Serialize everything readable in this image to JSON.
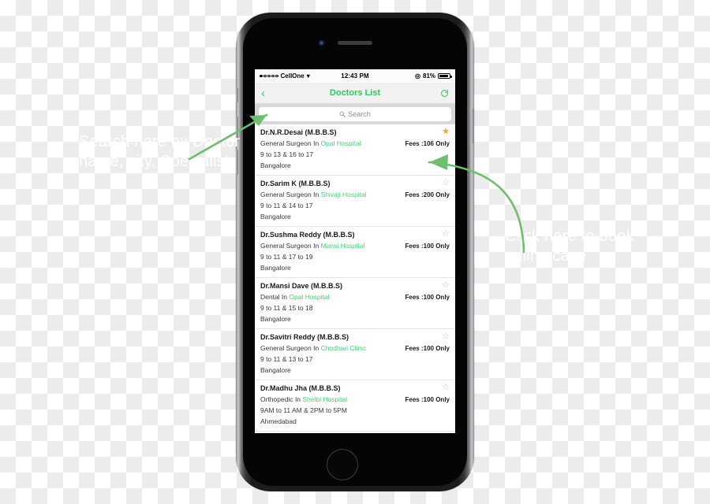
{
  "annotations": {
    "left": "Search here by Doctor name, city, Specialist",
    "right": "Click here to book online case"
  },
  "status_bar": {
    "carrier": "CellOne",
    "wifi_icon": "wifi-icon",
    "time": "12:43 PM",
    "bluetooth_icon": "bluetooth-icon",
    "battery_percent": "81%",
    "battery_icon": "battery-icon"
  },
  "nav_bar": {
    "back_icon": "chevron-left-icon",
    "title": "Doctors List",
    "refresh_icon": "refresh-icon"
  },
  "search": {
    "icon": "search-icon",
    "placeholder": "Search",
    "value": ""
  },
  "colors": {
    "accent_green": "#2ecc5a",
    "hospital_green": "#48d17a",
    "star_gold": "#f5a623",
    "arrow_green": "#6dbe6d",
    "navbar_gray": "#f2f2f2",
    "searchbar_gray": "#d8d8dc"
  },
  "doctors": [
    {
      "name": "Dr.N.R.Desai (M.B.B.S)",
      "specialty": "General Surgeon In ",
      "hospital": "Opal Hospital",
      "fees": "Fees :106 Only",
      "hours": "9 to 13 & 16 to 17",
      "city": "Bangalore",
      "favorite": true,
      "star_icon": "star-filled-icon"
    },
    {
      "name": "Dr.Sarim K (M.B.B.S)",
      "specialty": "General Surgeon In ",
      "hospital": "Shivaji Hospital",
      "fees": "Fees :200 Only",
      "hours": "9 to 11 & 14 to 17",
      "city": "Bangalore",
      "favorite": false,
      "star_icon": "star-outline-icon"
    },
    {
      "name": "Dr.Sushma Reddy (M.B.B.S)",
      "specialty": "General Surgeon In ",
      "hospital": "Mansi Hospital",
      "fees": "Fees :100 Only",
      "hours": "9 to 11 & 17 to 19",
      "city": "Bangalore",
      "favorite": false,
      "star_icon": "star-outline-icon"
    },
    {
      "name": "Dr.Mansi Dave (M.B.B.S)",
      "specialty": "Dental In ",
      "hospital": "Opal Hospital",
      "fees": "Fees :100 Only",
      "hours": "9 to 11 & 15 to 18",
      "city": "Bangalore",
      "favorite": false,
      "star_icon": "star-outline-icon"
    },
    {
      "name": "Dr.Savitri Reddy (M.B.B.S)",
      "specialty": "General Surgeon In ",
      "hospital": "Chodhari Clinic",
      "fees": "Fees :100 Only",
      "hours": "9 to 11 & 13 to 17",
      "city": "Bangalore",
      "favorite": false,
      "star_icon": "star-outline-icon"
    },
    {
      "name": "Dr.Madhu Jha (M.B.B.S)",
      "specialty": "Orthopedic In ",
      "hospital": "Shelbi Hospital",
      "fees": "Fees :100 Only",
      "hours": "9AM to 11 AM & 2PM to 5PM",
      "city": "Ahmedabad",
      "favorite": false,
      "star_icon": "star-outline-icon"
    }
  ]
}
